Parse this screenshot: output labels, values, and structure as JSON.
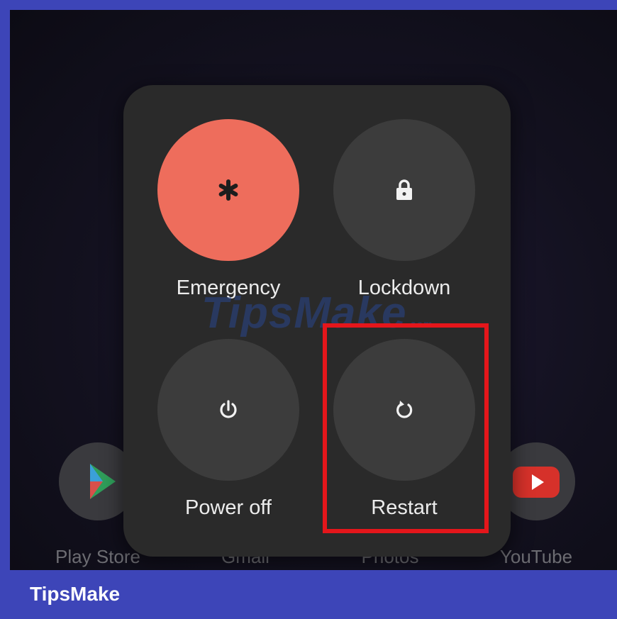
{
  "home_apps": [
    {
      "label": "Play Store",
      "icon": "play-store-icon"
    },
    {
      "label": "Gmail",
      "icon": "gmail-icon"
    },
    {
      "label": "Photos",
      "icon": "photos-icon"
    },
    {
      "label": "YouTube",
      "icon": "youtube-icon"
    }
  ],
  "power_menu": {
    "emergency": {
      "label": "Emergency",
      "icon": "asterisk-icon",
      "color": "#ee6d5c"
    },
    "lockdown": {
      "label": "Lockdown",
      "icon": "lock-icon"
    },
    "power_off": {
      "label": "Power off",
      "icon": "power-icon"
    },
    "restart": {
      "label": "Restart",
      "icon": "restart-icon"
    }
  },
  "highlight_color": "#e4161b",
  "watermark": {
    "text": "TipsMake",
    "suffix": ".com"
  },
  "brand": {
    "text": "TipsMake",
    "bar_color": "#3d45b8"
  }
}
